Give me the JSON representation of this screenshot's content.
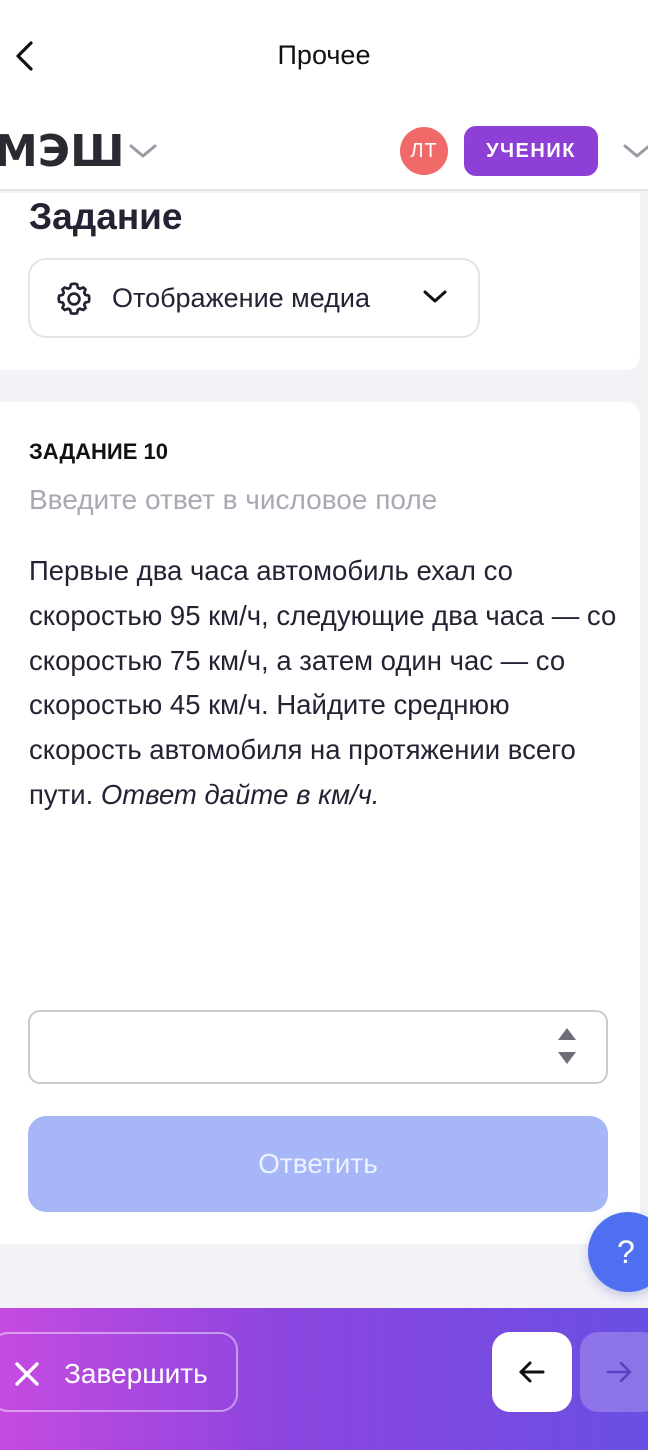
{
  "topbar": {
    "title": "Прочее",
    "back_icon": "chevron-left-icon"
  },
  "header": {
    "logo": "МЭШ",
    "avatar_initials": "ЛТ",
    "role": "УЧЕНИК",
    "avatar_color": "#f06a6a",
    "role_color": "#8d3fd6"
  },
  "task_panel": {
    "title": "Задание",
    "media_select": {
      "label": "Отображение медиа",
      "icon": "gear-icon"
    }
  },
  "task": {
    "number": "ЗАДАНИЕ 10",
    "hint": "Введите ответ в числовое поле",
    "text": "Первые два часа автомобиль ехал со скоростью 95 км/ч, следующие два часа — со скоростью 75 км/ч, а затем один час — со скоростью 45 км/ч. Найдите среднюю скорость автомобиля на протяжении всего пути. ",
    "text_note": "Ответ дайте в км/ч.",
    "answer_value": "",
    "submit_label": "Ответить",
    "submit_color": "#a6b6f7"
  },
  "help": {
    "label": "?"
  },
  "footer": {
    "finish_label": "Завершить",
    "gradient": [
      "#c54be0",
      "#8a45df",
      "#6a4fe2"
    ]
  }
}
